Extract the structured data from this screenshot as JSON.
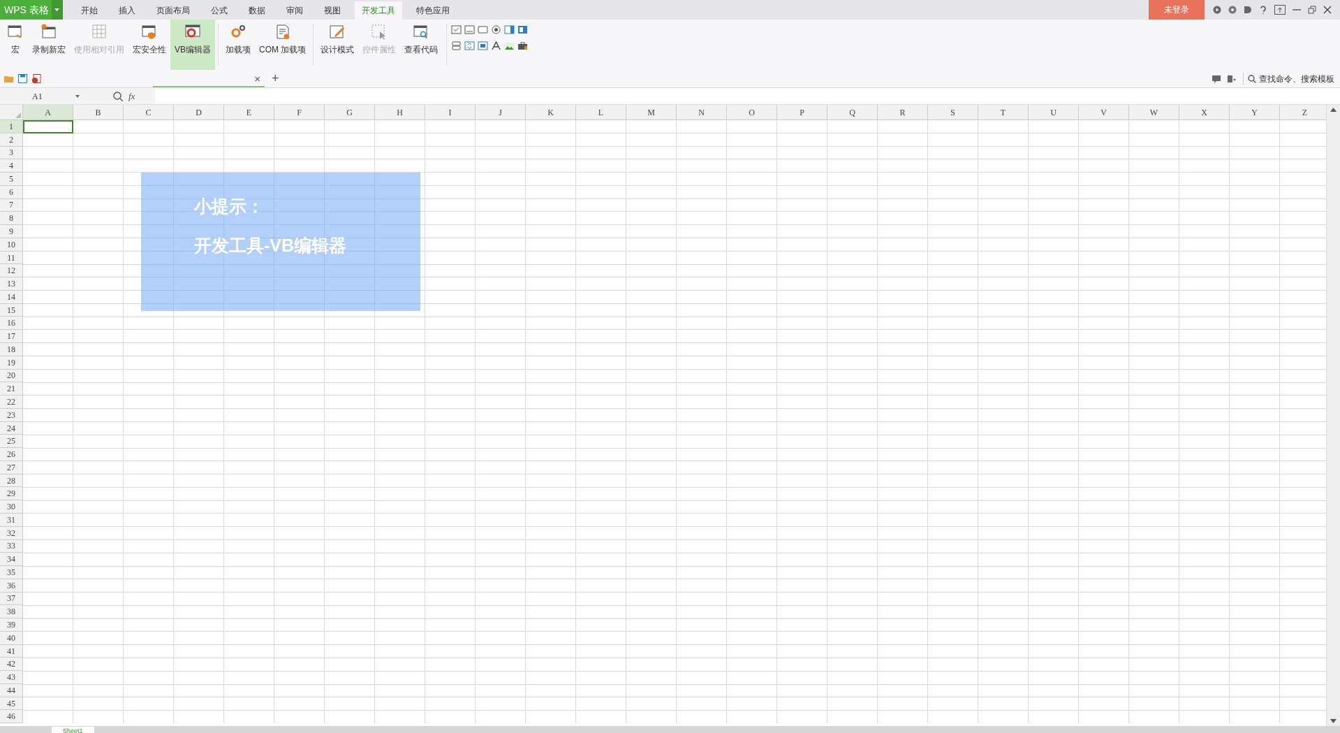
{
  "title_bar": {
    "app": "WPS 表格",
    "tabs": [
      {
        "label": "开始",
        "selected": false
      },
      {
        "label": "插入",
        "selected": false
      },
      {
        "label": "页面布局",
        "selected": false
      },
      {
        "label": "公式",
        "selected": false
      },
      {
        "label": "数据",
        "selected": false
      },
      {
        "label": "审阅",
        "selected": false
      },
      {
        "label": "视图",
        "selected": false
      },
      {
        "label": "开发工具",
        "selected": true
      },
      {
        "label": "特色应用",
        "selected": false
      }
    ],
    "login": "未登录"
  },
  "ribbon": {
    "buttons": [
      {
        "label": "宏",
        "disabled": false,
        "selected": false
      },
      {
        "label": "录制新宏",
        "disabled": false,
        "selected": false
      },
      {
        "label": "使用相对引用",
        "disabled": true,
        "selected": false
      },
      {
        "label": "宏安全性",
        "disabled": false,
        "selected": false
      },
      {
        "label": "VB编辑器",
        "disabled": false,
        "selected": true
      },
      {
        "label": "加载项",
        "disabled": false,
        "selected": false
      },
      {
        "label": "COM 加载项",
        "disabled": false,
        "selected": false
      },
      {
        "label": "设计模式",
        "disabled": false,
        "selected": false
      },
      {
        "label": "控件属性",
        "disabled": true,
        "selected": false
      },
      {
        "label": "查看代码",
        "disabled": false,
        "selected": false
      }
    ]
  },
  "doc_bar": {
    "close": "×",
    "new_tab": "+",
    "search": {
      "placeholder": "查找命令、搜索模板"
    }
  },
  "formula_bar": {
    "cell": "A1",
    "fx": "fx"
  },
  "sheet": {
    "columns": [
      {
        "label": "A",
        "selected": true
      },
      {
        "label": "B",
        "selected": false
      },
      {
        "label": "C",
        "selected": false
      },
      {
        "label": "D",
        "selected": false
      },
      {
        "label": "E",
        "selected": false
      },
      {
        "label": "F",
        "selected": false
      },
      {
        "label": "G",
        "selected": false
      },
      {
        "label": "H",
        "selected": false
      },
      {
        "label": "I",
        "selected": false
      },
      {
        "label": "J",
        "selected": false
      },
      {
        "label": "K",
        "selected": false
      },
      {
        "label": "L",
        "selected": false
      },
      {
        "label": "M",
        "selected": false
      },
      {
        "label": "N",
        "selected": false
      },
      {
        "label": "O",
        "selected": false
      },
      {
        "label": "P",
        "selected": false
      },
      {
        "label": "Q",
        "selected": false
      },
      {
        "label": "R",
        "selected": false
      },
      {
        "label": "S",
        "selected": false
      },
      {
        "label": "T",
        "selected": false
      },
      {
        "label": "U",
        "selected": false
      },
      {
        "label": "V",
        "selected": false
      },
      {
        "label": "W",
        "selected": false
      },
      {
        "label": "X",
        "selected": false
      },
      {
        "label": "Y",
        "selected": false
      },
      {
        "label": "Z",
        "selected": false
      }
    ],
    "rows": [
      {
        "label": "1",
        "selected": true
      },
      {
        "label": "2",
        "selected": false
      },
      {
        "label": "3",
        "selected": false
      },
      {
        "label": "4",
        "selected": false
      },
      {
        "label": "5",
        "selected": false
      },
      {
        "label": "6",
        "selected": false
      },
      {
        "label": "7",
        "selected": false
      },
      {
        "label": "8",
        "selected": false
      },
      {
        "label": "9",
        "selected": false
      },
      {
        "label": "10",
        "selected": false
      },
      {
        "label": "11",
        "selected": false
      },
      {
        "label": "12",
        "selected": false
      },
      {
        "label": "13",
        "selected": false
      },
      {
        "label": "14",
        "selected": false
      },
      {
        "label": "15",
        "selected": false
      },
      {
        "label": "16",
        "selected": false
      },
      {
        "label": "17",
        "selected": false
      },
      {
        "label": "18",
        "selected": false
      },
      {
        "label": "19",
        "selected": false
      },
      {
        "label": "20",
        "selected": false
      },
      {
        "label": "21",
        "selected": false
      },
      {
        "label": "22",
        "selected": false
      },
      {
        "label": "23",
        "selected": false
      },
      {
        "label": "24",
        "selected": false
      },
      {
        "label": "25",
        "selected": false
      },
      {
        "label": "26",
        "selected": false
      },
      {
        "label": "27",
        "selected": false
      },
      {
        "label": "28",
        "selected": false
      },
      {
        "label": "29",
        "selected": false
      },
      {
        "label": "30",
        "selected": false
      },
      {
        "label": "31",
        "selected": false
      },
      {
        "label": "32",
        "selected": false
      },
      {
        "label": "33",
        "selected": false
      },
      {
        "label": "34",
        "selected": false
      },
      {
        "label": "35",
        "selected": false
      },
      {
        "label": "36",
        "selected": false
      },
      {
        "label": "37",
        "selected": false
      },
      {
        "label": "38",
        "selected": false
      },
      {
        "label": "39",
        "selected": false
      },
      {
        "label": "40",
        "selected": false
      },
      {
        "label": "41",
        "selected": false
      },
      {
        "label": "42",
        "selected": false
      },
      {
        "label": "43",
        "selected": false
      },
      {
        "label": "44",
        "selected": false
      },
      {
        "label": "45",
        "selected": false
      },
      {
        "label": "46",
        "selected": false
      }
    ]
  },
  "sheet_tabs": [
    {
      "label": "Sheet1",
      "selected": true
    }
  ],
  "tip": {
    "title": "小提示：",
    "text": "开发工具-VB编辑器"
  }
}
